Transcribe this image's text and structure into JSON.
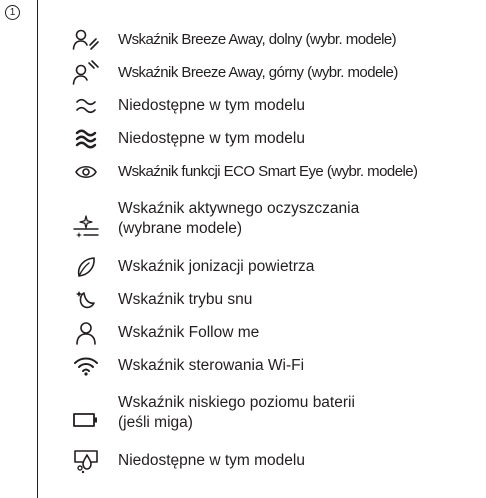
{
  "callout_number": "1",
  "rows": [
    {
      "icon": "person-wind-low-icon",
      "label": "Wskaźnik Breeze Away, dolny (wybr. modele)",
      "narrow": true
    },
    {
      "icon": "person-wind-high-icon",
      "label": "Wskaźnik Breeze Away, górny (wybr. modele)",
      "narrow": true
    },
    {
      "icon": "wave-lines-icon",
      "label": "Niedostępne w tym modelu",
      "narrow": false
    },
    {
      "icon": "wave-lines-bold-icon",
      "label": "Niedostępne w tym modelu",
      "narrow": false
    },
    {
      "icon": "eye-icon",
      "label": "Wskaźnik funkcji ECO Smart Eye (wybr. modele)",
      "narrow": true
    },
    {
      "icon": "sparkle-clean-icon",
      "label": "Wskaźnik aktywnego oczyszczania (wybrane modele)",
      "narrow": false
    },
    {
      "icon": "leaf-icon",
      "label": "Wskaźnik jonizacji powietrza",
      "narrow": false
    },
    {
      "icon": "sleep-mode-icon",
      "label": "Wskaźnik trybu snu",
      "narrow": false
    },
    {
      "icon": "person-icon",
      "label": "Wskaźnik Follow me",
      "narrow": false
    },
    {
      "icon": "wifi-icon",
      "label": "Wskaźnik sterowania Wi-Fi",
      "narrow": false
    },
    {
      "icon": "battery-icon",
      "label": "Wskaźnik niskiego poziomu baterii (jeśli miga)",
      "narrow": false
    },
    {
      "icon": "humidifier-icon",
      "label": "Niedostępne w tym modelu",
      "narrow": false
    }
  ]
}
